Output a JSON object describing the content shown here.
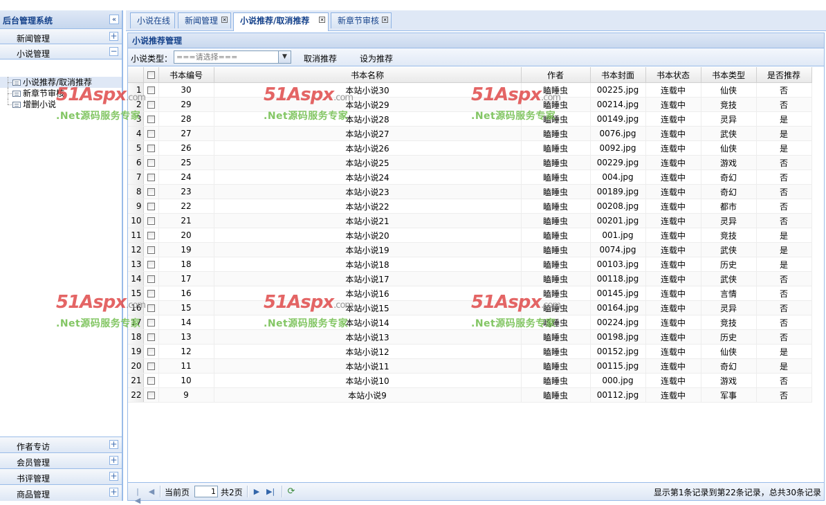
{
  "sidebar": {
    "title": "后台管理系统",
    "collapse_icon": "«",
    "top_sections": [
      {
        "label": "新闻管理",
        "toggle": "+"
      },
      {
        "label": "小说管理",
        "toggle": "−"
      }
    ],
    "tree_items": [
      {
        "label": "小说推荐/取消推荐"
      },
      {
        "label": "新章节审核"
      },
      {
        "label": "增删小说"
      }
    ],
    "bottom_sections": [
      {
        "label": "作者专访",
        "toggle": "+"
      },
      {
        "label": "会员管理",
        "toggle": "+"
      },
      {
        "label": "书评管理",
        "toggle": "+"
      },
      {
        "label": "商品管理",
        "toggle": "+"
      }
    ]
  },
  "tabs": [
    {
      "label": "小说在线",
      "closable": false
    },
    {
      "label": "新闻管理",
      "closable": true
    },
    {
      "label": "小说推荐/取消推荐",
      "closable": true,
      "active": true
    },
    {
      "label": "新章节审核",
      "closable": true
    }
  ],
  "panel": {
    "title": "小说推荐管理",
    "toolbar": {
      "type_label": "小说类型：",
      "type_placeholder": "===请选择===",
      "cancel_label": "取消推荐",
      "set_label": "设为推荐"
    }
  },
  "grid": {
    "columns": [
      "书本编号",
      "书本名称",
      "作者",
      "书本封面",
      "书本状态",
      "书本类型",
      "是否推荐"
    ],
    "rows": [
      {
        "n": "1",
        "id": "30",
        "name": "本站小说30",
        "author": "瞌睡虫",
        "cover": "00225.jpg",
        "status": "连载中",
        "type": "仙侠",
        "rec": "否"
      },
      {
        "n": "2",
        "id": "29",
        "name": "本站小说29",
        "author": "瞌睡虫",
        "cover": "00214.jpg",
        "status": "连载中",
        "type": "竞技",
        "rec": "否"
      },
      {
        "n": "3",
        "id": "28",
        "name": "本站小说28",
        "author": "瞌睡虫",
        "cover": "00149.jpg",
        "status": "连载中",
        "type": "灵异",
        "rec": "是"
      },
      {
        "n": "4",
        "id": "27",
        "name": "本站小说27",
        "author": "瞌睡虫",
        "cover": "0076.jpg",
        "status": "连载中",
        "type": "武侠",
        "rec": "是"
      },
      {
        "n": "5",
        "id": "26",
        "name": "本站小说26",
        "author": "瞌睡虫",
        "cover": "0092.jpg",
        "status": "连载中",
        "type": "仙侠",
        "rec": "是"
      },
      {
        "n": "6",
        "id": "25",
        "name": "本站小说25",
        "author": "瞌睡虫",
        "cover": "00229.jpg",
        "status": "连载中",
        "type": "游戏",
        "rec": "否"
      },
      {
        "n": "7",
        "id": "24",
        "name": "本站小说24",
        "author": "瞌睡虫",
        "cover": "004.jpg",
        "status": "连载中",
        "type": "奇幻",
        "rec": "否"
      },
      {
        "n": "8",
        "id": "23",
        "name": "本站小说23",
        "author": "瞌睡虫",
        "cover": "00189.jpg",
        "status": "连载中",
        "type": "奇幻",
        "rec": "否"
      },
      {
        "n": "9",
        "id": "22",
        "name": "本站小说22",
        "author": "瞌睡虫",
        "cover": "00208.jpg",
        "status": "连载中",
        "type": "都市",
        "rec": "否"
      },
      {
        "n": "10",
        "id": "21",
        "name": "本站小说21",
        "author": "瞌睡虫",
        "cover": "00201.jpg",
        "status": "连载中",
        "type": "灵异",
        "rec": "否"
      },
      {
        "n": "11",
        "id": "20",
        "name": "本站小说20",
        "author": "瞌睡虫",
        "cover": "001.jpg",
        "status": "连载中",
        "type": "竞技",
        "rec": "是"
      },
      {
        "n": "12",
        "id": "19",
        "name": "本站小说19",
        "author": "瞌睡虫",
        "cover": "0074.jpg",
        "status": "连载中",
        "type": "武侠",
        "rec": "是"
      },
      {
        "n": "13",
        "id": "18",
        "name": "本站小说18",
        "author": "瞌睡虫",
        "cover": "00103.jpg",
        "status": "连载中",
        "type": "历史",
        "rec": "是"
      },
      {
        "n": "14",
        "id": "17",
        "name": "本站小说17",
        "author": "瞌睡虫",
        "cover": "00118.jpg",
        "status": "连载中",
        "type": "武侠",
        "rec": "否"
      },
      {
        "n": "15",
        "id": "16",
        "name": "本站小说16",
        "author": "瞌睡虫",
        "cover": "00145.jpg",
        "status": "连载中",
        "type": "言情",
        "rec": "否"
      },
      {
        "n": "16",
        "id": "15",
        "name": "本站小说15",
        "author": "瞌睡虫",
        "cover": "00164.jpg",
        "status": "连载中",
        "type": "灵异",
        "rec": "否"
      },
      {
        "n": "17",
        "id": "14",
        "name": "本站小说14",
        "author": "瞌睡虫",
        "cover": "00224.jpg",
        "status": "连载中",
        "type": "竞技",
        "rec": "否"
      },
      {
        "n": "18",
        "id": "13",
        "name": "本站小说13",
        "author": "瞌睡虫",
        "cover": "00198.jpg",
        "status": "连载中",
        "type": "历史",
        "rec": "否"
      },
      {
        "n": "19",
        "id": "12",
        "name": "本站小说12",
        "author": "瞌睡虫",
        "cover": "00152.jpg",
        "status": "连载中",
        "type": "仙侠",
        "rec": "是"
      },
      {
        "n": "20",
        "id": "11",
        "name": "本站小说11",
        "author": "瞌睡虫",
        "cover": "00115.jpg",
        "status": "连载中",
        "type": "奇幻",
        "rec": "是"
      },
      {
        "n": "21",
        "id": "10",
        "name": "本站小说10",
        "author": "瞌睡虫",
        "cover": "000.jpg",
        "status": "连载中",
        "type": "游戏",
        "rec": "否"
      },
      {
        "n": "22",
        "id": "9",
        "name": "本站小说9",
        "author": "瞌睡虫",
        "cover": "00112.jpg",
        "status": "连载中",
        "type": "军事",
        "rec": "否"
      }
    ]
  },
  "pager": {
    "current_label": "当前页",
    "current_page": "1",
    "total_pages": "共2页",
    "summary": "显示第1条记录到第22条记录，总共30条记录"
  },
  "watermark": {
    "logo": "51Aspx",
    "com": ".com",
    "sub": ".Net源码服务专家"
  }
}
